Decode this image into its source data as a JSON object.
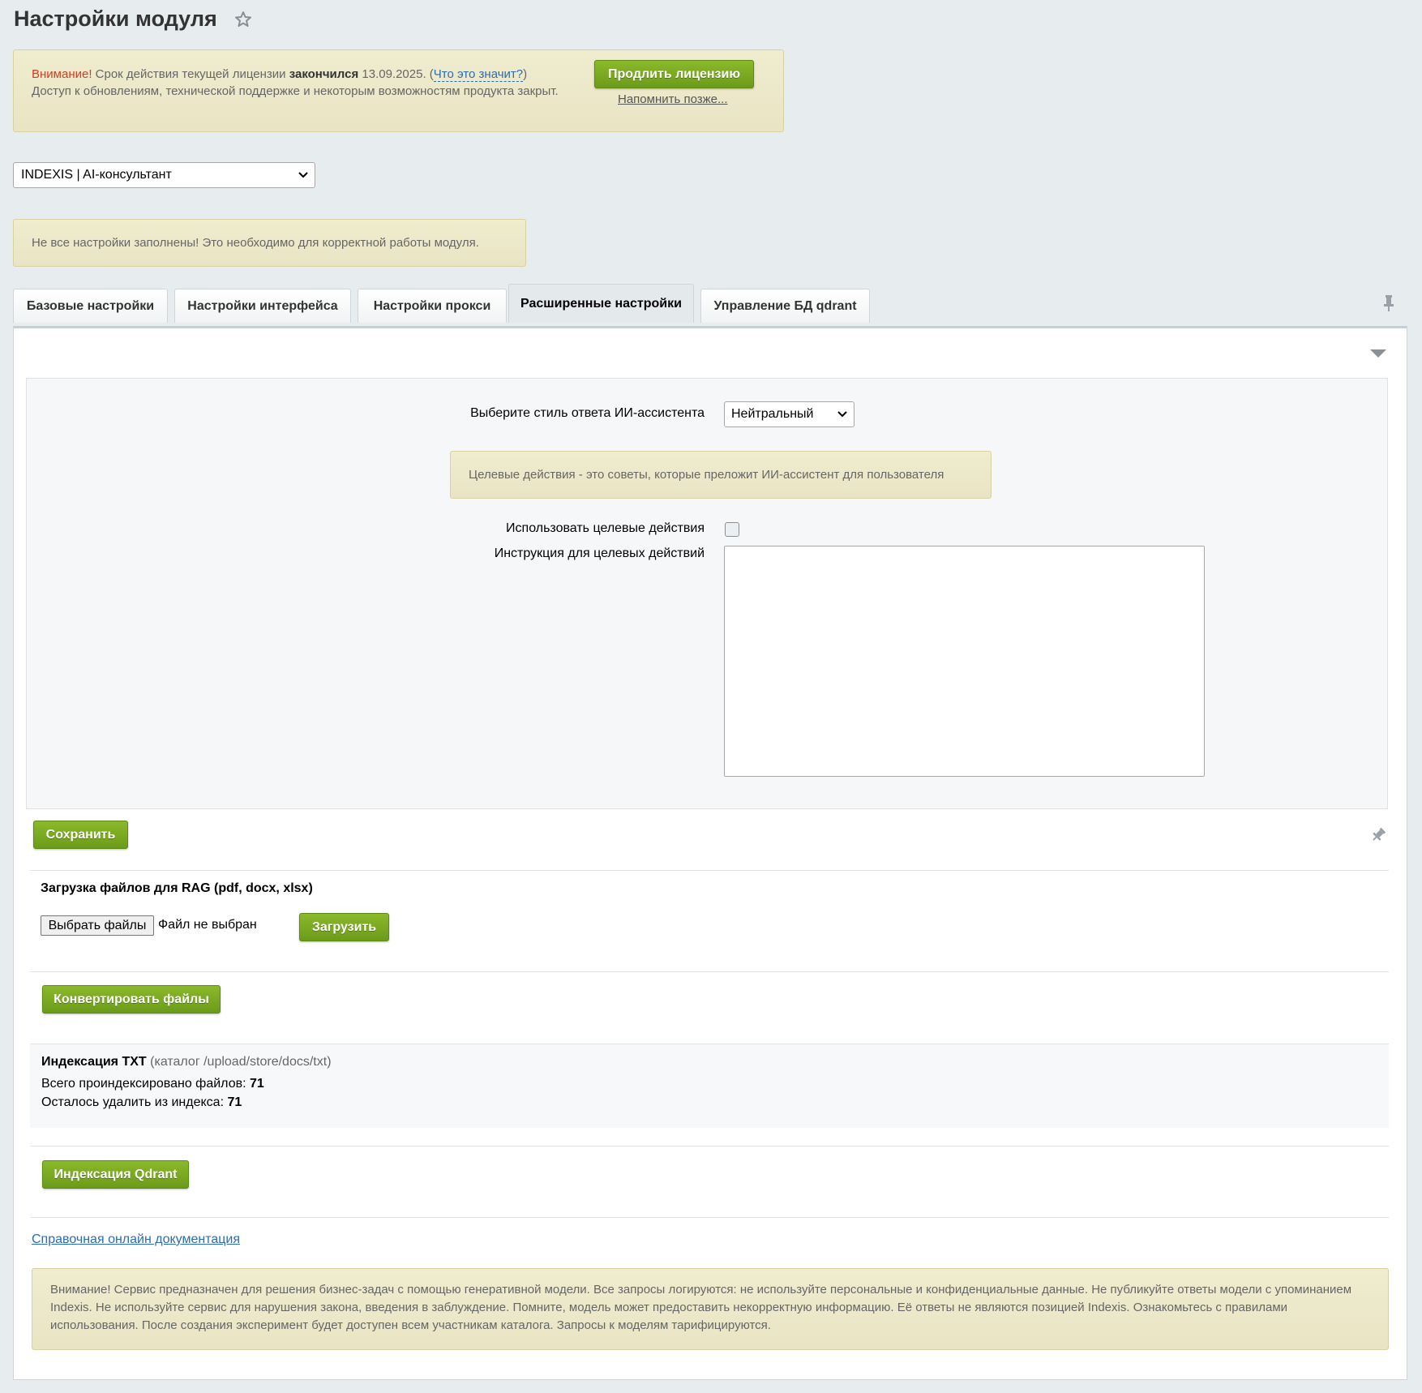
{
  "page": {
    "title": "Настройки модуля"
  },
  "license_notice": {
    "attention": "Внимание!",
    "text1": " Срок действия текущей лицензии ",
    "ended": "закончился",
    "date": " 13.09.2025. (",
    "help_link": "Что это значит?",
    "close_paren": ")",
    "line2": "Доступ к обновлениям, технической поддержке и некоторым возможностям продукта закрыт.",
    "renew_button": "Продлить лицензию",
    "remind_later": "Напомнить позже..."
  },
  "module_select": {
    "selected": "INDEXIS | AI-консультант"
  },
  "settings_notice": {
    "text": "Не все настройки заполнены! Это необходимо для корректной работы модуля."
  },
  "tabs": [
    {
      "label": "Базовые настройки"
    },
    {
      "label": "Настройки интерфейса"
    },
    {
      "label": "Настройки прокси"
    },
    {
      "label": "Расширенные настройки"
    },
    {
      "label": "Управление БД qdrant"
    }
  ],
  "form": {
    "style_label": "Выберите стиль ответа ИИ-ассистента",
    "style_selected": "Нейтральный",
    "target_notice": "Целевые действия - это советы, которые преложит ИИ-ассистент для пользователя",
    "use_target_label": "Использовать целевые действия",
    "use_target_checked": false,
    "instruction_label": "Инструкция для целевых действий",
    "instruction_value": ""
  },
  "actions": {
    "save": "Сохранить"
  },
  "rag": {
    "title": "Загрузка файлов для RAG (pdf, docx, xlsx)",
    "choose_files": "Выбрать файлы",
    "file_status": "Файл не выбран",
    "upload": "Загрузить",
    "convert": "Конвертировать файлы"
  },
  "indexing": {
    "title": "Индексация TXT",
    "path": " (каталог /upload/store/docs/txt)",
    "total_label": "Всего проиндексировано файлов: ",
    "total_value": "71",
    "remaining_label": "Осталось удалить из индекса: ",
    "remaining_value": "71",
    "qdrant_button": "Индексация Qdrant"
  },
  "footer": {
    "doc_link": "Справочная онлайн документация",
    "warning": "Внимание! Сервис предназначен для решения бизнес-задач с помощью генеративной модели. Все запросы логируются: не используйте персональные и конфиденциальные данные. Не публикуйте ответы модели с упоминанием Indexis. Не используйте сервис для нарушения закона, введения в заблуждение. Помните, модель может предоставить некорректную информацию. Её ответы не являются позицией Indexis. Ознакомьтесь с правилами использования. После создания эксперимент будет доступен всем участникам каталога. Запросы к моделям тарифицируются."
  },
  "colors": {
    "accent_green": "#7aab22",
    "notice_bg": "#ede9cb",
    "attention_red": "#d13d20",
    "link_blue": "#2b6bb5"
  },
  "icons": {
    "favorite": "star-icon",
    "pin": "pin-icon",
    "collapse": "triangle-down-icon",
    "select": "chevron-down-icon"
  }
}
